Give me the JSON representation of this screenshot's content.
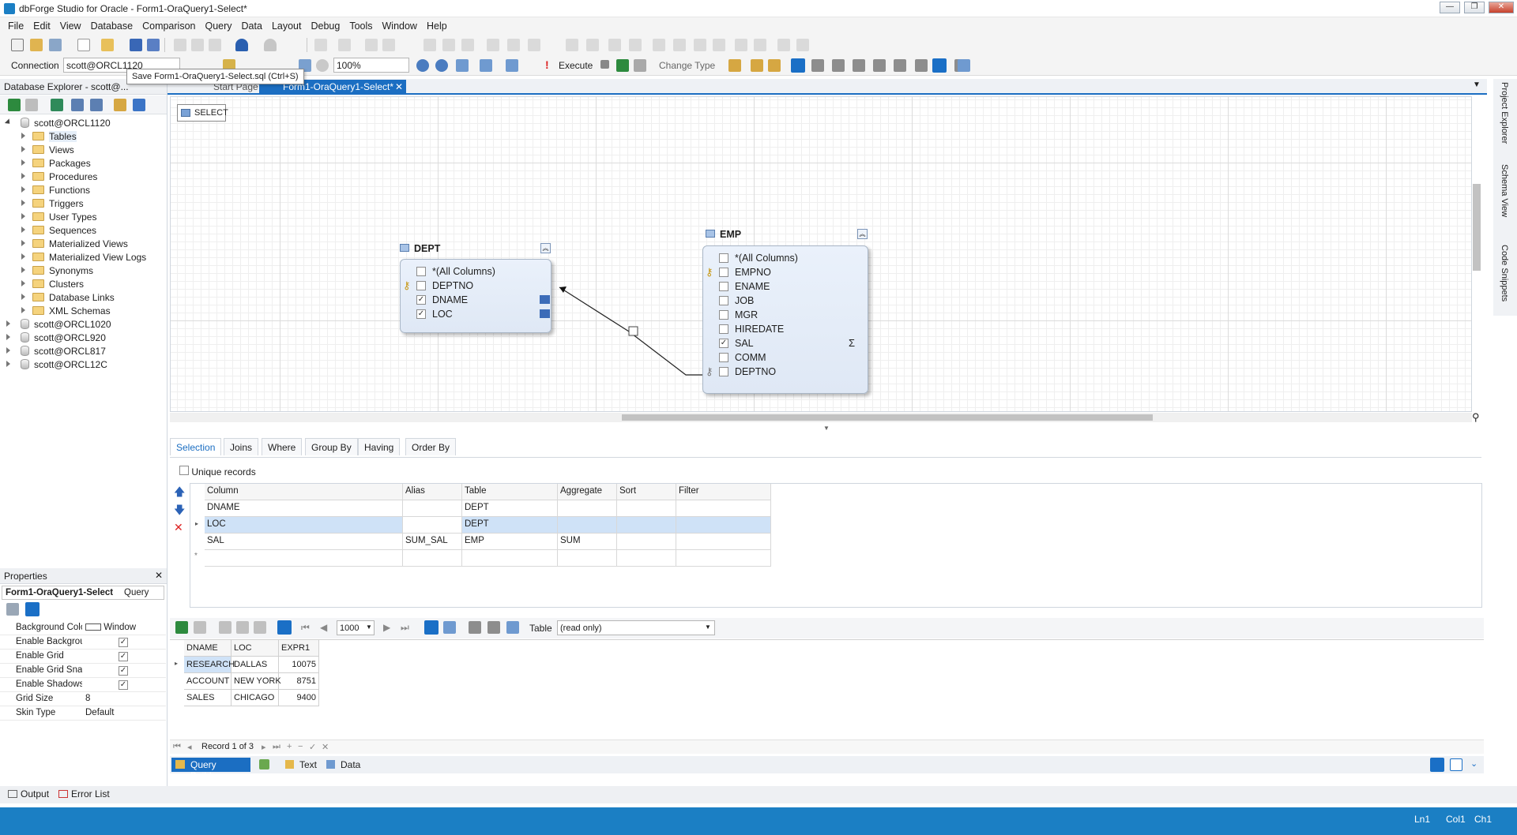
{
  "window": {
    "title": "dbForge Studio for Oracle - Form1-OraQuery1-Select*"
  },
  "menu": [
    "File",
    "Edit",
    "View",
    "Database",
    "Comparison",
    "Query",
    "Data",
    "Layout",
    "Debug",
    "Tools",
    "Window",
    "Help"
  ],
  "toolbar2": {
    "connection_label": "Connection",
    "connection_value": "scott@ORCL1120",
    "zoom": "100%",
    "execute": "Execute",
    "change_type": "Change Type"
  },
  "tooltip": "Save Form1-OraQuery1-Select.sql (Ctrl+S)",
  "dbexplorer": {
    "title": "Database Explorer - scott@...",
    "root": "scott@ORCL1120",
    "items": [
      "Tables",
      "Views",
      "Packages",
      "Procedures",
      "Functions",
      "Triggers",
      "User Types",
      "Sequences",
      "Materialized Views",
      "Materialized View Logs",
      "Synonyms",
      "Clusters",
      "Database Links",
      "XML Schemas"
    ],
    "others": [
      "scott@ORCL1020",
      "scott@ORCL920",
      "scott@ORCL817",
      "scott@ORCL12C"
    ]
  },
  "properties": {
    "title": "Properties",
    "object_name": "Form1-OraQuery1-Select",
    "object_type": "Query",
    "rows": [
      {
        "k": "Background Color",
        "v": "Window"
      },
      {
        "k": "Enable Background",
        "v": "✓"
      },
      {
        "k": "Enable Grid",
        "v": "✓"
      },
      {
        "k": "Enable Grid Snap",
        "v": "✓"
      },
      {
        "k": "Enable Shadows",
        "v": "✓"
      },
      {
        "k": "Grid Size",
        "v": "8"
      },
      {
        "k": "Skin Type",
        "v": "Default"
      }
    ]
  },
  "tabs": {
    "start": "Start Page",
    "active": "Form1-OraQuery1-Select*"
  },
  "canvas": {
    "select_label": "SELECT",
    "dept": {
      "name": "DEPT",
      "cols": [
        "*(All Columns)",
        "DEPTNO",
        "DNAME",
        "LOC"
      ],
      "checked": [
        false,
        false,
        true,
        true
      ]
    },
    "emp": {
      "name": "EMP",
      "cols": [
        "*(All Columns)",
        "EMPNO",
        "ENAME",
        "JOB",
        "MGR",
        "HIREDATE",
        "SAL",
        "COMM",
        "DEPTNO"
      ],
      "checked": [
        false,
        false,
        false,
        false,
        false,
        false,
        true,
        false,
        false
      ],
      "sigma": "Σ"
    }
  },
  "qtabs": [
    "Selection",
    "Joins",
    "Where",
    "Group By",
    "Having",
    "Order By"
  ],
  "unique_records": "Unique records",
  "grid": {
    "headers": [
      "Column",
      "Alias",
      "Table",
      "Aggregate",
      "Sort",
      "Filter"
    ],
    "rows": [
      [
        "DNAME",
        "",
        "DEPT",
        "",
        "",
        ""
      ],
      [
        "LOC",
        "",
        "DEPT",
        "",
        "",
        ""
      ],
      [
        "SAL",
        "SUM_SAL",
        "EMP",
        "SUM",
        "",
        ""
      ]
    ]
  },
  "results": {
    "page_size": "1000",
    "table_label": "Table",
    "table_mode": "(read only)",
    "headers": [
      "DNAME",
      "LOC",
      "EXPR1"
    ],
    "rows": [
      [
        "RESEARCH",
        "DALLAS",
        "10075"
      ],
      [
        "ACCOUNT",
        "NEW YORK",
        "8751"
      ],
      [
        "SALES",
        "CHICAGO",
        "9400"
      ]
    ],
    "record": "Record 1 of 3"
  },
  "viewtabs": {
    "qb": "Query Builder",
    "text": "Text",
    "data": "Data"
  },
  "bottomtabs": {
    "output": "Output",
    "errors": "Error List"
  },
  "status": {
    "ln": "Ln1",
    "col": "Col1",
    "ch": "Ch1"
  },
  "rightpanel": [
    "Project Explorer",
    "Schema View",
    "Code Snippets"
  ]
}
